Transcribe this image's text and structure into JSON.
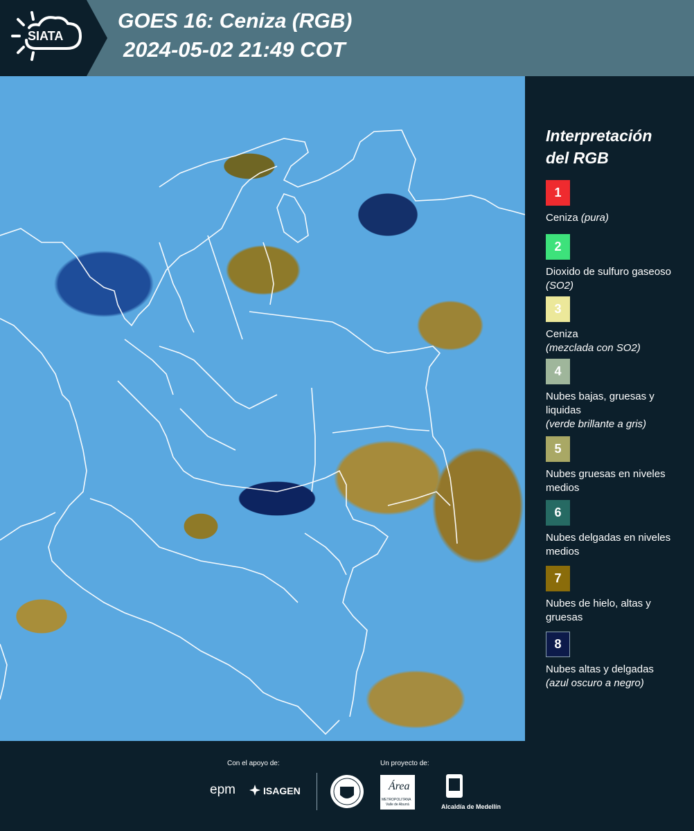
{
  "header": {
    "logo_text": "SIATA",
    "title": "GOES 16: Ceniza (RGB)",
    "timestamp": "2024-05-02 21:49 COT"
  },
  "legend": {
    "title_line1": "Interpretación",
    "title_line2": "del RGB",
    "items": [
      {
        "number": "1",
        "color": "#ef2b2f",
        "text": "Ceniza ",
        "note": "(pura)"
      },
      {
        "number": "2",
        "color": "#3de27b",
        "text": "Dioxido de sulfuro gaseoso ",
        "note": "(SO2)"
      },
      {
        "number": "3",
        "color": "#ece89a",
        "text": "Ceniza",
        "note": "(mezclada con SO2)"
      },
      {
        "number": "4",
        "color": "#9fb69b",
        "text": "Nubes bajas, gruesas y liquidas",
        "note": "(verde brillante a gris)"
      },
      {
        "number": "5",
        "color": "#a9a865",
        "text": "Nubes gruesas en niveles medios",
        "note": ""
      },
      {
        "number": "6",
        "color": "#266a63",
        "text": "Nubes delgadas en niveles medios",
        "note": ""
      },
      {
        "number": "7",
        "color": "#8a6c0a",
        "text": "Nubes de hielo, altas y gruesas",
        "note": ""
      },
      {
        "number": "8",
        "color": "#0c1a4a",
        "text": "Nubes altas y delgadas",
        "note": "(azul oscuro a negro)"
      }
    ]
  },
  "footer": {
    "support_label": "Con el apoyo de:",
    "project_label": "Un proyecto de:",
    "sponsor_epm": "epm",
    "sponsor_isagen": "ISAGEN",
    "area_name": "Área",
    "area_sub": "METROPOLITANA",
    "area_sub2": "Valle de Aburrá",
    "alcaldia": "Alcaldía de Medellín"
  }
}
